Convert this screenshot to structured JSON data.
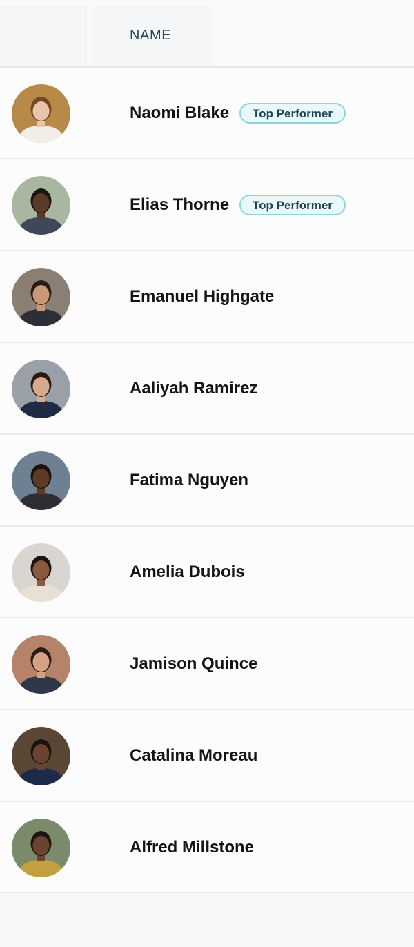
{
  "table": {
    "header": {
      "name_label": "NAME"
    },
    "badge_label": "Top Performer",
    "rows": [
      {
        "name": "Naomi Blake",
        "badge": "Top Performer",
        "avatar": {
          "bg": "#b88a4a",
          "skin": "#e8c4a8",
          "hair": "#7a4526",
          "cloth": "#f2ede6"
        }
      },
      {
        "name": "Elias Thorne",
        "badge": "Top Performer",
        "avatar": {
          "bg": "#a9b6a0",
          "skin": "#5a3a28",
          "hair": "#1c1512",
          "cloth": "#3e4858"
        }
      },
      {
        "name": "Emanuel Highgate",
        "badge": "",
        "avatar": {
          "bg": "#8a7f72",
          "skin": "#c99877",
          "hair": "#2a1c14",
          "cloth": "#2c2f36"
        }
      },
      {
        "name": "Aaliyah Ramirez",
        "badge": "",
        "avatar": {
          "bg": "#9aa0a8",
          "skin": "#d6ab8c",
          "hair": "#2a1a12",
          "cloth": "#1f2a44"
        }
      },
      {
        "name": "Fatima Nguyen",
        "badge": "",
        "avatar": {
          "bg": "#6f8092",
          "skin": "#5c3a26",
          "hair": "#1a1210",
          "cloth": "#2e2e32"
        }
      },
      {
        "name": "Amelia Dubois",
        "badge": "",
        "avatar": {
          "bg": "#d9d6d2",
          "skin": "#8a5a3c",
          "hair": "#1c1410",
          "cloth": "#e8e0d2"
        }
      },
      {
        "name": "Jamison Quince",
        "badge": "",
        "avatar": {
          "bg": "#b5836a",
          "skin": "#d4a184",
          "hair": "#2a1c14",
          "cloth": "#2f3848"
        }
      },
      {
        "name": "Catalina Moreau",
        "badge": "",
        "avatar": {
          "bg": "#5a4634",
          "skin": "#6a4430",
          "hair": "#1a1210",
          "cloth": "#1e2a4a"
        }
      },
      {
        "name": "Alfred Millstone",
        "badge": "",
        "avatar": {
          "bg": "#7a8a6a",
          "skin": "#6a4430",
          "hair": "#1c1410",
          "cloth": "#c2a040"
        }
      }
    ]
  }
}
